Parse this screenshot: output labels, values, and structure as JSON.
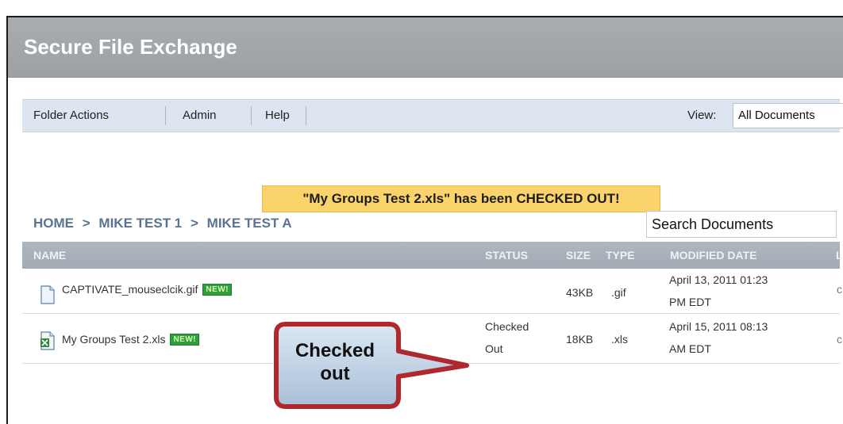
{
  "app": {
    "title": "Secure File Exchange"
  },
  "menu": {
    "items": [
      "Folder Actions",
      "Admin",
      "Help"
    ],
    "view_label": "View:",
    "view_value": "All Documents"
  },
  "notice": "\"My Groups Test 2.xls\" has been CHECKED OUT!",
  "breadcrumb": [
    "HOME",
    ">",
    "MIKE TEST 1",
    ">",
    "MIKE TEST A"
  ],
  "search": {
    "value": "Search Documents"
  },
  "table": {
    "headers": [
      "NAME",
      "STATUS",
      "SIZE",
      "TYPE",
      "MODIFIED DATE",
      "L"
    ],
    "rows": [
      {
        "name": "CAPTIVATE_mouseclcik.gif",
        "badge": "NEW!",
        "status_line1": "",
        "status_line2": "",
        "size": "43KB",
        "type": ".gif",
        "date_line1": "April 13, 2011 01:23",
        "date_line2": "PM EDT",
        "file_icon": "document-icon",
        "last": "c"
      },
      {
        "name": "My Groups Test 2.xls",
        "badge": "NEW!",
        "status_line1": "Checked",
        "status_line2": "Out",
        "size": "18KB",
        "type": ".xls",
        "date_line1": "April 15, 2011 08:13",
        "date_line2": "AM EDT",
        "file_icon": "excel-file-icon",
        "last": "c"
      }
    ]
  },
  "callout": {
    "line1": "Checked",
    "line2": "out"
  },
  "colors": {
    "header": "#a0a4a7",
    "menubar": "#dde6f0",
    "notice": "#fbd36b",
    "table_header": "#a8b0b9",
    "badge": "#2f9e3c",
    "callout_border": "#b0272c",
    "callout_fill": "#c5d6e8"
  }
}
